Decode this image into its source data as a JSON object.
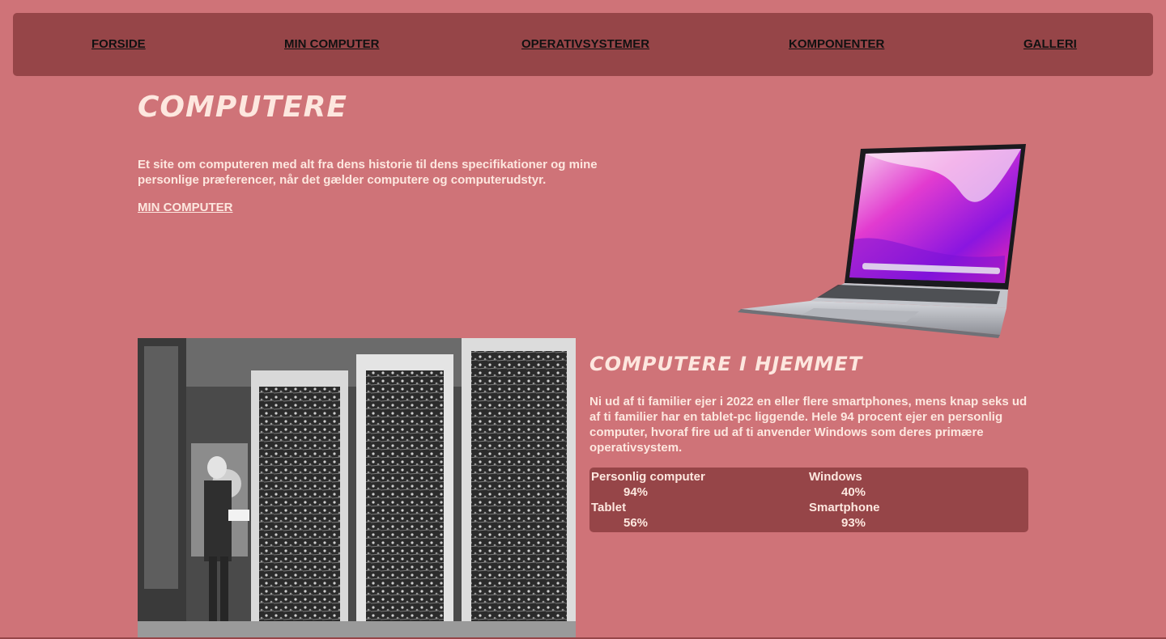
{
  "nav": {
    "items": [
      {
        "label": "FORSIDE"
      },
      {
        "label": "MIN COMPUTER"
      },
      {
        "label": "OPERATIVSYSTEMER"
      },
      {
        "label": "KOMPONENTER"
      },
      {
        "label": "GALLERI"
      }
    ]
  },
  "hero": {
    "title": "COMPUTERE",
    "text": "Et site om computeren med alt fra dens historie til dens specifikationer og mine personlige præferencer, når det gælder computere og computerudstyr.",
    "link_label": "MIN COMPUTER"
  },
  "section": {
    "title": "COMPUTERE I HJEMMET",
    "text": "Ni ud af ti familier ejer i 2022 en eller flere smartphones, mens knap seks ud af ti familier har en tablet-pc liggende. Hele 94 procent ejer en personlig computer, hvoraf fire ud af ti anvender Windows som deres primære operativsystem."
  },
  "stats": [
    {
      "label": "Personlig computer",
      "value": "94%"
    },
    {
      "label": "Windows",
      "value": "40%"
    },
    {
      "label": "Tablet",
      "value": "56%"
    },
    {
      "label": "Smartphone",
      "value": "93%"
    }
  ],
  "colors": {
    "background": "#cf7378",
    "panel": "#964548",
    "text_light": "#fde7df"
  }
}
